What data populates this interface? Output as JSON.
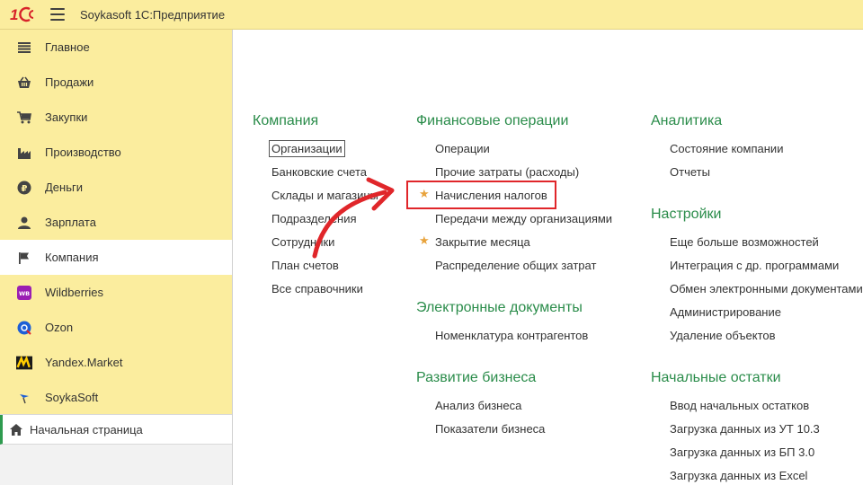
{
  "app": {
    "title": "Soykasoft 1С:Предприятие",
    "logo_text": "1С"
  },
  "sidebar": {
    "items": [
      {
        "label": "Главное",
        "icon": "list-icon"
      },
      {
        "label": "Продажи",
        "icon": "basket-icon"
      },
      {
        "label": "Закупки",
        "icon": "cart-icon"
      },
      {
        "label": "Производство",
        "icon": "factory-icon"
      },
      {
        "label": "Деньги",
        "icon": "ruble-coin-icon"
      },
      {
        "label": "Зарплата",
        "icon": "person-icon"
      },
      {
        "label": "Компания",
        "icon": "flag-icon",
        "active": true
      },
      {
        "label": "Wildberries",
        "icon": "wildberries-logo-icon",
        "badge": "WB"
      },
      {
        "label": "Ozon",
        "icon": "ozon-logo-icon"
      },
      {
        "label": "Yandex.Market",
        "icon": "yandex-market-logo-icon"
      },
      {
        "label": "SoykaSoft",
        "icon": "soykasoft-logo-icon"
      }
    ],
    "home": {
      "label": "Начальная страница",
      "icon": "home-icon"
    }
  },
  "sections": {
    "company": {
      "title": "Компания",
      "links": [
        "Организации",
        "Банковские счета",
        "Склады и магазины",
        "Подразделения",
        "Сотрудники",
        "План счетов",
        "Все справочники"
      ]
    },
    "finance": {
      "title": "Финансовые операции",
      "links": [
        "Операции",
        "Прочие затраты (расходы)",
        "Начисления налогов",
        "Передачи между организациями",
        "Закрытие месяца",
        "Распределение общих затрат"
      ]
    },
    "edocs": {
      "title": "Электронные документы",
      "links": [
        "Номенклатура контрагентов"
      ]
    },
    "business": {
      "title": "Развитие бизнеса",
      "links": [
        "Анализ бизнеса",
        "Показатели бизнеса"
      ]
    },
    "analytics": {
      "title": "Аналитика",
      "links": [
        "Состояние компании",
        "Отчеты"
      ]
    },
    "settings": {
      "title": "Настройки",
      "links": [
        "Еще больше возможностей",
        "Интеграция с др. программами",
        "Обмен электронными документами",
        "Администрирование",
        "Удаление объектов"
      ]
    },
    "opening": {
      "title": "Начальные остатки",
      "links": [
        "Ввод начальных остатков",
        "Загрузка данных из УТ 10.3",
        "Загрузка данных из БП 3.0",
        "Загрузка данных из Excel"
      ]
    }
  },
  "colors": {
    "accent_green": "#2a8c4a",
    "sidebar_bg": "#fbed9e",
    "highlight_red": "#e0262a",
    "star": "#e8a33c"
  }
}
